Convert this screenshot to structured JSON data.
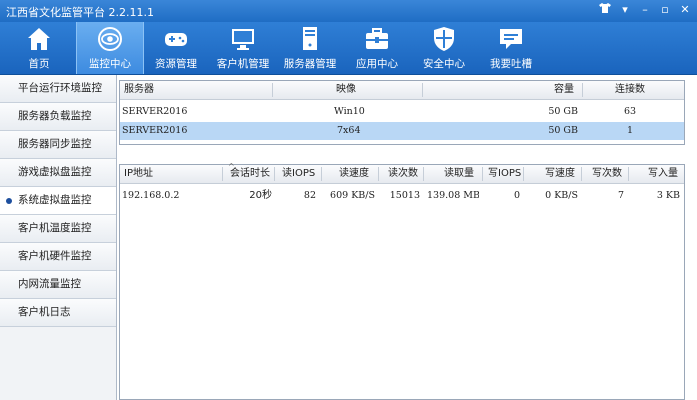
{
  "window": {
    "title": "江西省文化监管平台 2.2.11.1"
  },
  "toolbar": {
    "items": [
      {
        "label": "首页",
        "icon": "home-icon"
      },
      {
        "label": "监控中心",
        "icon": "eye-icon"
      },
      {
        "label": "资源管理",
        "icon": "gamepad-icon"
      },
      {
        "label": "客户机管理",
        "icon": "monitor-icon"
      },
      {
        "label": "服务器管理",
        "icon": "server-icon"
      },
      {
        "label": "应用中心",
        "icon": "toolbox-icon"
      },
      {
        "label": "安全中心",
        "icon": "shield-icon"
      },
      {
        "label": "我要吐槽",
        "icon": "chat-icon"
      }
    ]
  },
  "sidebar": {
    "items": [
      {
        "label": "平台运行环境监控"
      },
      {
        "label": "服务器负载监控"
      },
      {
        "label": "服务器同步监控"
      },
      {
        "label": "游戏虚拟盘监控"
      },
      {
        "label": "系统虚拟盘监控"
      },
      {
        "label": "客户机温度监控"
      },
      {
        "label": "客户机硬件监控"
      },
      {
        "label": "内网流量监控"
      },
      {
        "label": "客户机日志"
      }
    ]
  },
  "top_table": {
    "headers": [
      "服务器",
      "映像",
      "容量",
      "连接数"
    ],
    "rows": [
      [
        "SERVER2016",
        "Win10",
        "50 GB",
        "63"
      ],
      [
        "SERVER2016",
        "7x64",
        "50 GB",
        "1"
      ]
    ]
  },
  "bottom_table": {
    "headers": [
      "IP地址",
      "会话时长",
      "读IOPS",
      "读速度",
      "读次数",
      "读取量",
      "写IOPS",
      "写速度",
      "写次数",
      "写入量"
    ],
    "rows": [
      [
        "192.168.0.2",
        "20秒",
        "82",
        "609 KB/S",
        "15013",
        "139.08 MB",
        "0",
        "0 KB/S",
        "7",
        "3 KB"
      ]
    ]
  }
}
